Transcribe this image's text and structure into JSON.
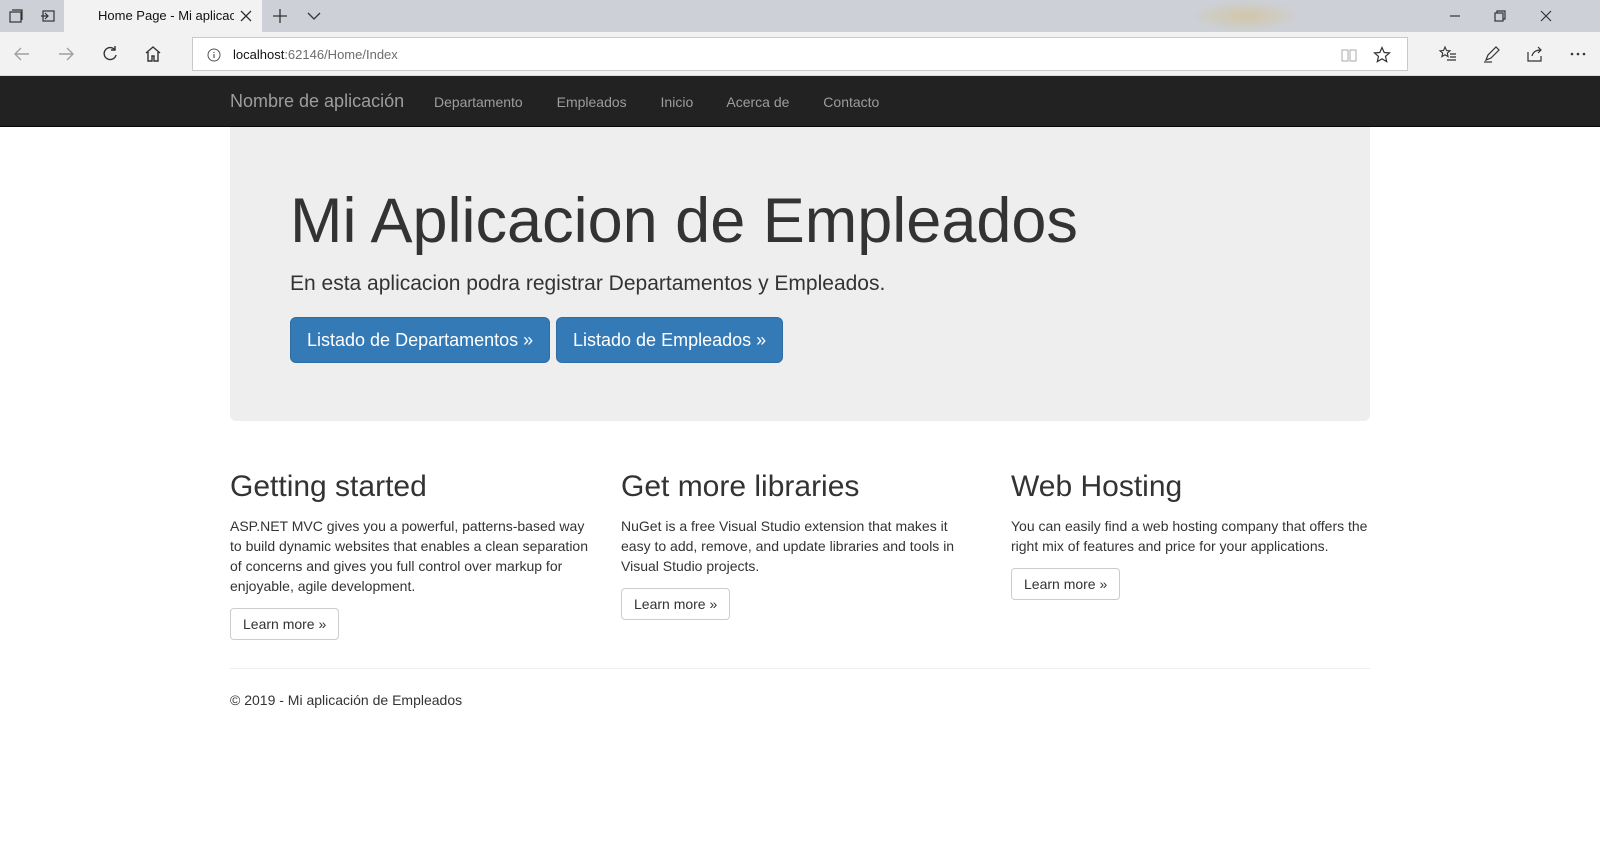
{
  "browser": {
    "tab_title": "Home Page - Mi aplicac",
    "url_host": "localhost",
    "url_path": ":62146/Home/Index"
  },
  "navbar": {
    "brand": "Nombre de aplicación",
    "links": [
      "Departamento",
      "Empleados",
      "Inicio",
      "Acerca de",
      "Contacto"
    ]
  },
  "jumbotron": {
    "title": "Mi Aplicacion de Empleados",
    "lead": "En esta aplicacion podra registrar Departamentos y Empleados.",
    "buttons": [
      "Listado de Departamentos »",
      "Listado de Empleados »"
    ]
  },
  "columns": [
    {
      "heading": "Getting started",
      "text": "ASP.NET MVC gives you a powerful, patterns-based way to build dynamic websites that enables a clean separation of concerns and gives you full control over markup for enjoyable, agile development.",
      "button": "Learn more »"
    },
    {
      "heading": "Get more libraries",
      "text": "NuGet is a free Visual Studio extension that makes it easy to add, remove, and update libraries and tools in Visual Studio projects.",
      "button": "Learn more »"
    },
    {
      "heading": "Web Hosting",
      "text": "You can easily find a web hosting company that offers the right mix of features and price for your applications.",
      "button": "Learn more »"
    }
  ],
  "footer": {
    "text": "© 2019 - Mi aplicación de Empleados"
  },
  "colors": {
    "navbar_bg": "#222222",
    "jumbotron_bg": "#eeeeee",
    "primary": "#337ab7"
  },
  "icons": [
    "tab-list-icon",
    "set-aside-icon",
    "close-tab-icon",
    "new-tab-icon",
    "tab-menu-icon",
    "minimize-icon",
    "restore-icon",
    "close-window-icon",
    "back-icon",
    "forward-icon",
    "refresh-icon",
    "home-icon",
    "info-icon",
    "reading-view-icon",
    "favorite-star-icon",
    "favorites-hub-icon",
    "pen-icon",
    "share-icon",
    "more-icon"
  ]
}
